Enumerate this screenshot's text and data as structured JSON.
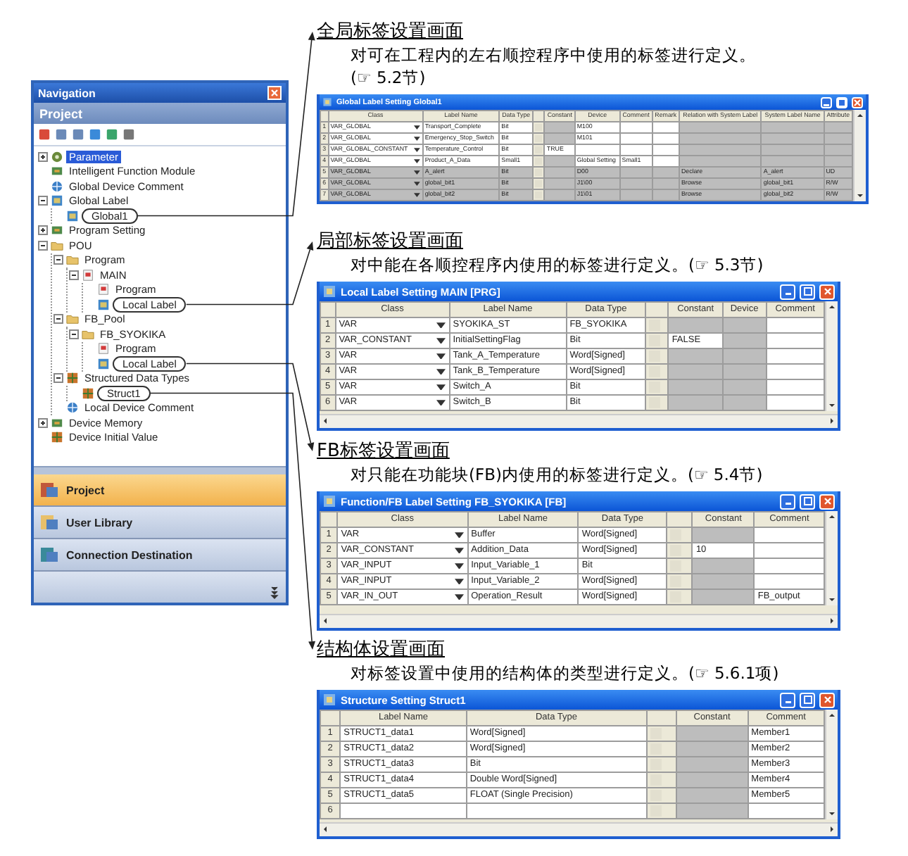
{
  "navigation": {
    "title": "Navigation",
    "header": "Project",
    "tree": [
      {
        "label": "Parameter",
        "kind": "gear",
        "expanded": false,
        "selected": true,
        "circled": false
      },
      {
        "label": "Intelligent Function Module",
        "kind": "chip",
        "selected": false,
        "circled": false
      },
      {
        "label": "Global Device Comment",
        "kind": "globe",
        "selected": false,
        "circled": false
      },
      {
        "label": "Global Label",
        "kind": "tag",
        "expanded": true,
        "selected": false,
        "circled": false,
        "children": [
          {
            "label": "Global1",
            "kind": "tag",
            "selected": false,
            "circled": true
          }
        ]
      },
      {
        "label": "Program Setting",
        "kind": "chip",
        "expanded": false,
        "selected": false,
        "circled": false
      },
      {
        "label": "POU",
        "kind": "folder",
        "expanded": true,
        "selected": false,
        "circled": false,
        "children": [
          {
            "label": "Program",
            "kind": "folder",
            "expanded": true,
            "selected": false,
            "circled": false,
            "children": [
              {
                "label": "MAIN",
                "kind": "document",
                "expanded": true,
                "selected": false,
                "circled": false,
                "children": [
                  {
                    "label": "Program",
                    "kind": "document",
                    "selected": false,
                    "circled": false
                  },
                  {
                    "label": "Local Label",
                    "kind": "tag",
                    "selected": false,
                    "circled": true
                  }
                ]
              }
            ]
          },
          {
            "label": "FB_Pool",
            "kind": "folder",
            "expanded": true,
            "selected": false,
            "circled": false,
            "children": [
              {
                "label": "FB_SYOKIKA",
                "kind": "folder",
                "expanded": true,
                "selected": false,
                "circled": false,
                "children": [
                  {
                    "label": "Program",
                    "kind": "document",
                    "selected": false,
                    "circled": false
                  },
                  {
                    "label": "Local Label",
                    "kind": "tag",
                    "selected": false,
                    "circled": true
                  }
                ]
              }
            ]
          },
          {
            "label": "Structured Data Types",
            "kind": "grid",
            "expanded": true,
            "selected": false,
            "circled": false,
            "children": [
              {
                "label": "Struct1",
                "kind": "grid",
                "selected": false,
                "circled": true
              }
            ]
          },
          {
            "label": "Local Device Comment",
            "kind": "globe",
            "selected": false,
            "circled": false
          }
        ]
      },
      {
        "label": "Device Memory",
        "kind": "chip",
        "expanded": false,
        "selected": false,
        "circled": false
      },
      {
        "label": "Device Initial Value",
        "kind": "grid",
        "selected": false,
        "circled": false
      }
    ],
    "tabs": [
      {
        "label": "Project",
        "selected": true
      },
      {
        "label": "User Library",
        "selected": false
      },
      {
        "label": "Connection Destination",
        "selected": false
      }
    ]
  },
  "sections": [
    {
      "heading": "全局标签设置画面",
      "description": "对可在工程内的左右顺控程序中使用的标签进行定义。",
      "reference": "(☞ 5.2节)",
      "reference_on_new_line": true,
      "window": {
        "title": "Global Label Setting Global1",
        "columns": [
          {
            "label": "Class",
            "kind": "dropdown"
          },
          {
            "label": "Label Name",
            "kind": "text"
          },
          {
            "label": "Data Type",
            "kind": "browse"
          },
          {
            "label": "Constant",
            "kind": "text",
            "shaded": true
          },
          {
            "label": "Device",
            "kind": "text"
          },
          {
            "label": "Comment",
            "kind": "text"
          },
          {
            "label": "Remark",
            "kind": "text"
          },
          {
            "label": "Relation with System Label",
            "kind": "text",
            "shaded": true
          },
          {
            "label": "System Label Name",
            "kind": "text",
            "shaded": true
          },
          {
            "label": "Attribute",
            "kind": "text",
            "shaded": true
          }
        ],
        "rows": [
          {
            "number": "1",
            "disabled": false,
            "cells": [
              "VAR_GLOBAL",
              "Transport_Complete",
              "Bit",
              "",
              "M100",
              "",
              "",
              "",
              "",
              ""
            ]
          },
          {
            "number": "2",
            "disabled": false,
            "cells": [
              "VAR_GLOBAL",
              "Emergency_Stop_Switch",
              "Bit",
              "",
              "M101",
              "",
              "",
              "",
              "",
              ""
            ]
          },
          {
            "number": "3",
            "disabled": false,
            "cells": [
              "VAR_GLOBAL_CONSTANT",
              "Temperature_Control",
              "Bit",
              "TRUE",
              "",
              "",
              "",
              "",
              "",
              ""
            ]
          },
          {
            "number": "4",
            "disabled": false,
            "cells": [
              "VAR_GLOBAL",
              "Product_A_Data",
              "Small1",
              "",
              "Global Setting",
              "Small1",
              "",
              "",
              "",
              ""
            ]
          },
          {
            "number": "5",
            "disabled": true,
            "cells": [
              "VAR_GLOBAL",
              "A_alert",
              "Bit",
              "",
              "D00",
              "",
              "",
              "Declare",
              "A_alert",
              "UD"
            ]
          },
          {
            "number": "6",
            "disabled": true,
            "cells": [
              "VAR_GLOBAL",
              "global_bit1",
              "Bit",
              "",
              "J1\\00",
              "",
              "",
              "Browse",
              "global_bit1",
              "R/W"
            ]
          },
          {
            "number": "7",
            "disabled": true,
            "cells": [
              "VAR_GLOBAL",
              "global_bit2",
              "Bit",
              "",
              "J1\\01",
              "",
              "",
              "Browse",
              "global_bit2",
              "R/W"
            ]
          }
        ]
      }
    },
    {
      "heading": "局部标签设置画面",
      "description": "对中能在各顺控程序内使用的标签进行定义。",
      "reference": "(☞ 5.3节)",
      "reference_on_new_line": false,
      "window": {
        "title": "Local Label Setting MAIN [PRG]",
        "columns": [
          {
            "label": "Class",
            "kind": "dropdown"
          },
          {
            "label": "Label Name",
            "kind": "text"
          },
          {
            "label": "Data Type",
            "kind": "browse"
          },
          {
            "label": "Constant",
            "kind": "text",
            "shaded": true
          },
          {
            "label": "Device",
            "kind": "text",
            "shaded": true
          },
          {
            "label": "Comment",
            "kind": "text"
          }
        ],
        "rows": [
          {
            "number": "1",
            "disabled": false,
            "cells": [
              "VAR",
              "SYOKIKA_ST",
              "FB_SYOKIKA",
              "",
              "",
              ""
            ]
          },
          {
            "number": "2",
            "disabled": false,
            "cells": [
              "VAR_CONSTANT",
              "InitialSettingFlag",
              "Bit",
              "FALSE",
              "",
              ""
            ]
          },
          {
            "number": "3",
            "disabled": false,
            "cells": [
              "VAR",
              "Tank_A_Temperature",
              "Word[Signed]",
              "",
              "",
              ""
            ]
          },
          {
            "number": "4",
            "disabled": false,
            "cells": [
              "VAR",
              "Tank_B_Temperature",
              "Word[Signed]",
              "",
              "",
              ""
            ]
          },
          {
            "number": "5",
            "disabled": false,
            "cells": [
              "VAR",
              "Switch_A",
              "Bit",
              "",
              "",
              ""
            ]
          },
          {
            "number": "6",
            "disabled": false,
            "cells": [
              "VAR",
              "Switch_B",
              "Bit",
              "",
              "",
              ""
            ]
          }
        ]
      }
    },
    {
      "heading": "FB标签设置画面",
      "description": "对只能在功能块(FB)内使用的标签进行定义。",
      "reference": "(☞ 5.4节)",
      "reference_on_new_line": false,
      "window": {
        "title": "Function/FB Label Setting FB_SYOKIKA [FB]",
        "columns": [
          {
            "label": "Class",
            "kind": "dropdown"
          },
          {
            "label": "Label Name",
            "kind": "text"
          },
          {
            "label": "Data Type",
            "kind": "browse"
          },
          {
            "label": "Constant",
            "kind": "text",
            "shaded": true
          },
          {
            "label": "Comment",
            "kind": "text"
          }
        ],
        "rows": [
          {
            "number": "1",
            "disabled": false,
            "cells": [
              "VAR",
              "Buffer",
              "Word[Signed]",
              "",
              ""
            ]
          },
          {
            "number": "2",
            "disabled": false,
            "cells": [
              "VAR_CONSTANT",
              "Addition_Data",
              "Word[Signed]",
              "10",
              ""
            ]
          },
          {
            "number": "3",
            "disabled": false,
            "cells": [
              "VAR_INPUT",
              "Input_Variable_1",
              "Bit",
              "",
              ""
            ]
          },
          {
            "number": "4",
            "disabled": false,
            "cells": [
              "VAR_INPUT",
              "Input_Variable_2",
              "Word[Signed]",
              "",
              ""
            ]
          },
          {
            "number": "5",
            "disabled": false,
            "cells": [
              "VAR_IN_OUT",
              "Operation_Result",
              "Word[Signed]",
              "",
              "FB_output"
            ]
          }
        ]
      }
    },
    {
      "heading": "结构体设置画面",
      "description": "对标签设置中使用的结构体的类型进行定义。",
      "reference": "(☞ 5.6.1项)",
      "reference_on_new_line": false,
      "window": {
        "title": "Structure Setting Struct1",
        "columns": [
          {
            "label": "Label Name",
            "kind": "text"
          },
          {
            "label": "Data Type",
            "kind": "browse"
          },
          {
            "label": "Constant",
            "kind": "text",
            "shaded": true
          },
          {
            "label": "Comment",
            "kind": "text"
          }
        ],
        "rows": [
          {
            "number": "1",
            "disabled": false,
            "cells": [
              "STRUCT1_data1",
              "Word[Signed]",
              "",
              "Member1"
            ]
          },
          {
            "number": "2",
            "disabled": false,
            "cells": [
              "STRUCT1_data2",
              "Word[Signed]",
              "",
              "Member2"
            ]
          },
          {
            "number": "3",
            "disabled": false,
            "cells": [
              "STRUCT1_data3",
              "Bit",
              "",
              "Member3"
            ]
          },
          {
            "number": "4",
            "disabled": false,
            "cells": [
              "STRUCT1_data4",
              "Double Word[Signed]",
              "",
              "Member4"
            ]
          },
          {
            "number": "5",
            "disabled": false,
            "cells": [
              "STRUCT1_data5",
              "FLOAT (Single Precision)",
              "",
              "Member5"
            ]
          },
          {
            "number": "6",
            "disabled": false,
            "cells": [
              "",
              "",
              "",
              ""
            ]
          }
        ]
      }
    }
  ]
}
